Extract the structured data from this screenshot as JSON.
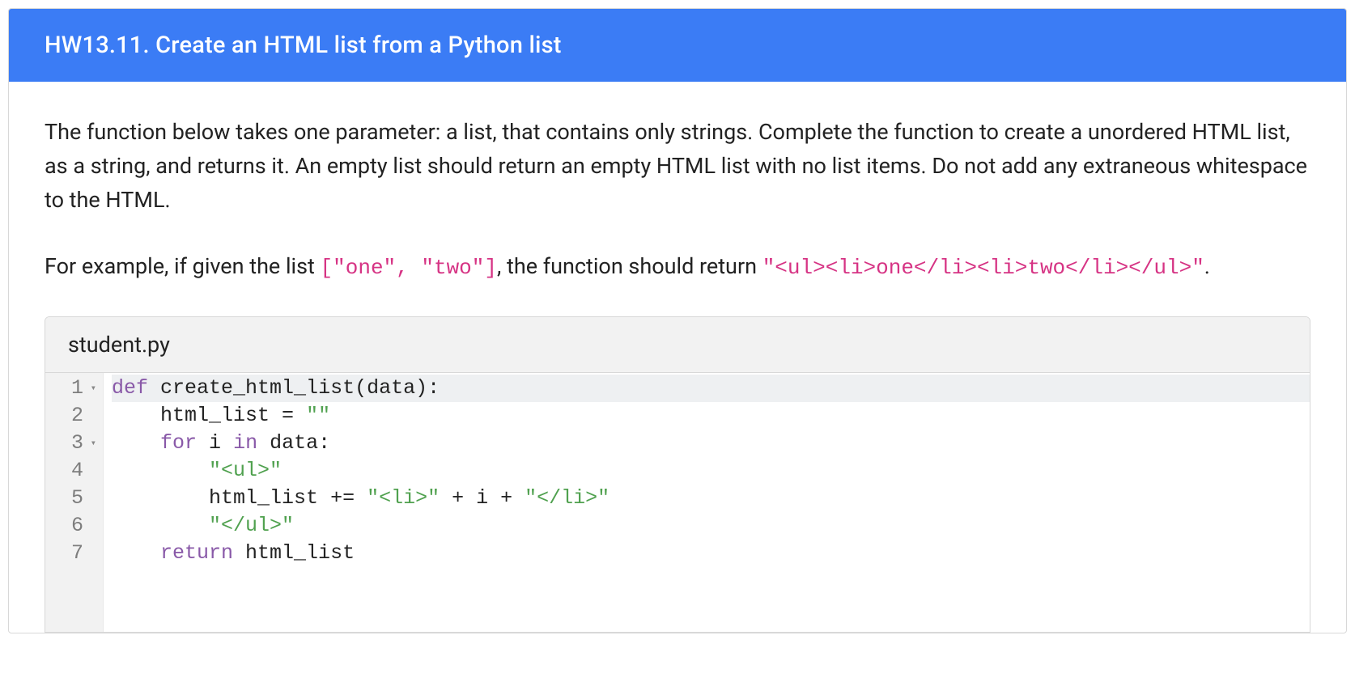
{
  "header": {
    "title": "HW13.11. Create an HTML list from a Python list"
  },
  "prompt": {
    "p1": "The function below takes one parameter: a list, that contains only strings. Complete the function to create a unordered HTML list, as a string, and returns it. An empty list should return an empty HTML list with no list items. Do not add any extraneous whitespace to the HTML.",
    "p2_prefix": "For example, if given the list ",
    "p2_code1": "[\"one\", \"two\"]",
    "p2_mid": ", the function should return ",
    "p2_code2": "\"<ul><li>one</li><li>two</li></ul>\"",
    "p2_suffix": "."
  },
  "editor": {
    "filename": "student.py",
    "lines": [
      {
        "n": "1",
        "fold": true
      },
      {
        "n": "2",
        "fold": false
      },
      {
        "n": "3",
        "fold": true
      },
      {
        "n": "4",
        "fold": false
      },
      {
        "n": "5",
        "fold": false
      },
      {
        "n": "6",
        "fold": false
      },
      {
        "n": "7",
        "fold": false
      }
    ],
    "code": {
      "l1": {
        "kw": "def",
        "sp": " ",
        "fn": "create_html_list",
        "paren": "(data):"
      },
      "l2": {
        "indent": "    ",
        "id": "html_list",
        "op": " = ",
        "str": "\"\""
      },
      "l3": {
        "indent": "    ",
        "kw1": "for",
        "sp1": " ",
        "id1": "i",
        "sp2": " ",
        "kw2": "in",
        "sp3": " ",
        "id2": "data:"
      },
      "l4": {
        "indent": "        ",
        "str": "\"<ul>\""
      },
      "l5": {
        "indent": "        ",
        "id": "html_list",
        "op1": " += ",
        "str1": "\"<li>\"",
        "op2": " + ",
        "id2": "i",
        "op3": " + ",
        "str2": "\"</li>\""
      },
      "l6": {
        "indent": "        ",
        "str": "\"</ul>\""
      },
      "l7": {
        "indent": "    ",
        "kw": "return",
        "sp": " ",
        "id": "html_list"
      }
    }
  }
}
